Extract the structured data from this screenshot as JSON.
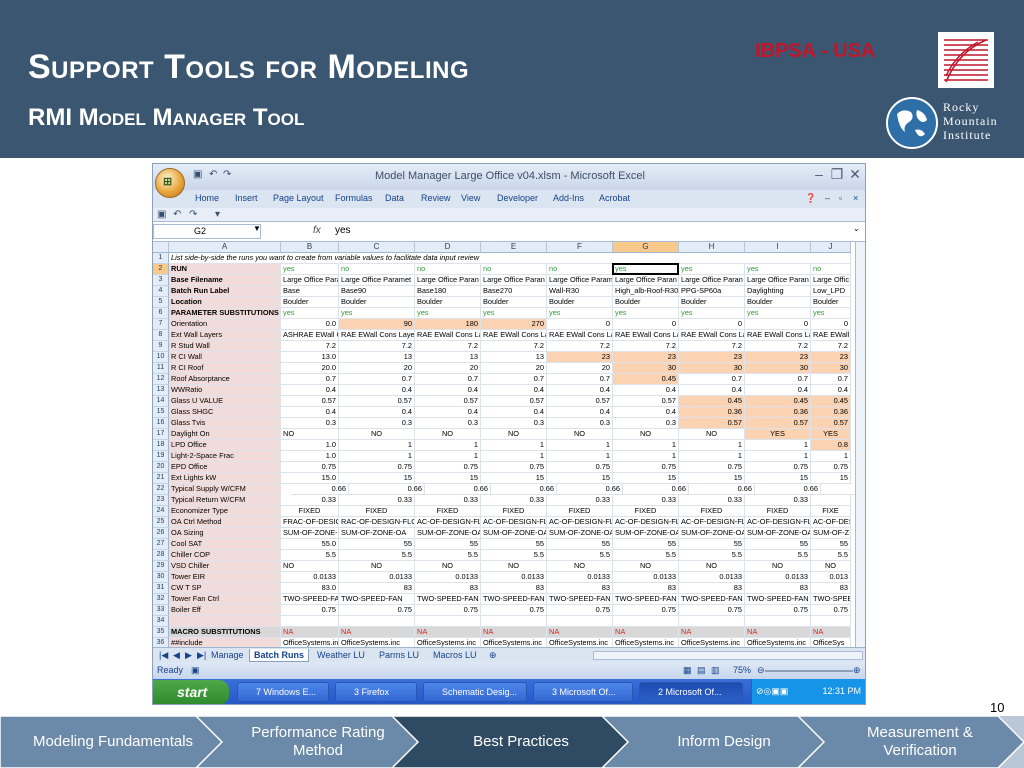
{
  "slide": {
    "title": "Support Tools for Modeling",
    "subtitle": "RMI Model Manager Tool",
    "ibpsa": "IBPSA - USA",
    "rmi_name": [
      "Rocky",
      "Mountain",
      "Institute"
    ],
    "page_number": "10"
  },
  "excel": {
    "window_title": "Model Manager Large Office v04.xlsm - Microsoft Excel",
    "ribbon_tabs": [
      "Home",
      "Insert",
      "Page Layout",
      "Formulas",
      "Data",
      "Review",
      "View",
      "Developer",
      "Add-Ins",
      "Acrobat"
    ],
    "name_box": "G2",
    "formula_value": "yes",
    "columns": [
      "A",
      "B",
      "C",
      "D",
      "E",
      "F",
      "G",
      "H",
      "I",
      "J"
    ],
    "rows": [
      {
        "n": "1",
        "cells": [
          "List side-by-side the runs you want to create from variable values to facilitate data input review"
        ]
      },
      {
        "n": "2",
        "cells": [
          "RUN",
          "yes",
          "no",
          "no",
          "no",
          "no",
          "yes",
          "yes",
          "yes",
          "no"
        ]
      },
      {
        "n": "3",
        "cells": [
          "Base Filename",
          "Large Office Para",
          "Large Office Paramet",
          "Large Office Paran",
          "Large Office Paran",
          "Large Office Param",
          "Large Office Paran",
          "Large Office Paran",
          "Large Office Paran",
          "Large Offic"
        ]
      },
      {
        "n": "4",
        "cells": [
          "Batch Run Label",
          "Base",
          "Base90",
          "Base180",
          "Base270",
          "Wall-R30",
          "High_alb-Roof-R30",
          "PPG-SP60a",
          "Daylighting",
          "Low_LPD"
        ]
      },
      {
        "n": "5",
        "cells": [
          "Location",
          "Boulder",
          "Boulder",
          "Boulder",
          "Boulder",
          "Boulder",
          "Boulder",
          "Boulder",
          "Boulder",
          "Boulder"
        ]
      },
      {
        "n": "6",
        "cells": [
          "PARAMETER SUBSTITUTIONS",
          "yes",
          "yes",
          "yes",
          "yes",
          "yes",
          "yes",
          "yes",
          "yes",
          "yes"
        ]
      },
      {
        "n": "7",
        "cells": [
          "Orientation",
          "0.0",
          "90",
          "180",
          "270",
          "0",
          "0",
          "0",
          "0",
          "0"
        ]
      },
      {
        "n": "8",
        "cells": [
          "Ext Wall Layers",
          "ASHRAE EWall C-H",
          "RAE EWall Cons Laye",
          "RAE EWall Cons La",
          "RAE EWall Cons La",
          "RAE EWall Cons Lay",
          "RAE EWall Cons La",
          "RAE EWall Cons La",
          "RAE EWall Cons La",
          "RAE EWall"
        ]
      },
      {
        "n": "9",
        "cells": [
          "R Stud Wall",
          "7.2",
          "7.2",
          "7.2",
          "7.2",
          "7.2",
          "7.2",
          "7.2",
          "7.2",
          "7.2"
        ]
      },
      {
        "n": "10",
        "cells": [
          "R CI Wall",
          "13.0",
          "13",
          "13",
          "13",
          "23",
          "23",
          "23",
          "23",
          "23"
        ]
      },
      {
        "n": "11",
        "cells": [
          "R CI Roof",
          "20.0",
          "20",
          "20",
          "20",
          "20",
          "30",
          "30",
          "30",
          "30"
        ]
      },
      {
        "n": "12",
        "cells": [
          "Roof Absorptance",
          "0.7",
          "0.7",
          "0.7",
          "0.7",
          "0.7",
          "0.45",
          "0.7",
          "0.7",
          "0.7"
        ]
      },
      {
        "n": "13",
        "cells": [
          "WWRatio",
          "0.4",
          "0.4",
          "0.4",
          "0.4",
          "0.4",
          "0.4",
          "0.4",
          "0.4",
          "0.4"
        ]
      },
      {
        "n": "14",
        "cells": [
          "Glass U VALUE",
          "0.57",
          "0.57",
          "0.57",
          "0.57",
          "0.57",
          "0.57",
          "0.45",
          "0.45",
          "0.45"
        ]
      },
      {
        "n": "15",
        "cells": [
          "Glass SHGC",
          "0.4",
          "0.4",
          "0.4",
          "0.4",
          "0.4",
          "0.4",
          "0.36",
          "0.36",
          "0.36"
        ]
      },
      {
        "n": "16",
        "cells": [
          "Glass Tvis",
          "0.3",
          "0.3",
          "0.3",
          "0.3",
          "0.3",
          "0.3",
          "0.57",
          "0.57",
          "0.57"
        ]
      },
      {
        "n": "17",
        "cells": [
          "Daylight On",
          "NO",
          "NO",
          "NO",
          "NO",
          "NO",
          "NO",
          "NO",
          "YES",
          "YES"
        ]
      },
      {
        "n": "18",
        "cells": [
          "LPD Office",
          "1.0",
          "1",
          "1",
          "1",
          "1",
          "1",
          "1",
          "1",
          "0.8"
        ]
      },
      {
        "n": "19",
        "cells": [
          "Light-2-Space Frac",
          "1.0",
          "1",
          "1",
          "1",
          "1",
          "1",
          "1",
          "1",
          "1"
        ]
      },
      {
        "n": "20",
        "cells": [
          "EPD Office",
          "0.75",
          "0.75",
          "0.75",
          "0.75",
          "0.75",
          "0.75",
          "0.75",
          "0.75",
          "0.75"
        ]
      },
      {
        "n": "21",
        "cells": [
          "Ext Lights kW",
          "15.0",
          "15",
          "15",
          "15",
          "15",
          "15",
          "15",
          "15",
          "15"
        ]
      },
      {
        "n": "22",
        "cells": [
          "Typical Supply W/CFM",
          "0.66",
          "0.66",
          "0.66",
          "0.66",
          "0.66",
          "0.66",
          "0.66",
          "0.66",
          ""
        ]
      },
      {
        "n": "23",
        "cells": [
          "Typical Return W/CFM",
          "0.33",
          "0.33",
          "0.33",
          "0.33",
          "0.33",
          "0.33",
          "0.33",
          "0.33",
          ""
        ]
      },
      {
        "n": "24",
        "cells": [
          "Economizer Type",
          "FIXED",
          "FIXED",
          "FIXED",
          "FIXED",
          "FIXED",
          "FIXED",
          "FIXED",
          "FIXED",
          "FIXE"
        ]
      },
      {
        "n": "25",
        "cells": [
          "OA Ctrl Method",
          "FRAC-OF-DESIGN",
          "RAC-OF-DESIGN-FLO",
          "AC-OF-DESIGN-FLC",
          "AC-OF-DESIGN-FLC",
          "AC-OF-DESIGN-FLO",
          "AC-OF-DESIGN-FLC",
          "AC-OF-DESIGN-FLC",
          "AC-OF-DESIGN-FLC",
          "AC-OF-DES"
        ]
      },
      {
        "n": "26",
        "cells": [
          "OA Sizing",
          "SUM-OF-ZONE-C",
          "SUM-OF-ZONE-OA",
          "SUM-OF-ZONE-OA",
          "SUM-OF-ZONE-OA",
          "SUM-OF-ZONE-OA",
          "SUM-OF-ZONE-OA",
          "SUM-OF-ZONE-OA",
          "SUM-OF-ZONE-OA",
          "SUM-OF-Z"
        ]
      },
      {
        "n": "27",
        "cells": [
          "Cool SAT",
          "55.0",
          "55",
          "55",
          "55",
          "55",
          "55",
          "55",
          "55",
          "55"
        ]
      },
      {
        "n": "28",
        "cells": [
          "Chiller COP",
          "5.5",
          "5.5",
          "5.5",
          "5.5",
          "5.5",
          "5.5",
          "5.5",
          "5.5",
          "5.5"
        ]
      },
      {
        "n": "29",
        "cells": [
          "VSD Chiller",
          "NO",
          "NO",
          "NO",
          "NO",
          "NO",
          "NO",
          "NO",
          "NO",
          "NO"
        ]
      },
      {
        "n": "30",
        "cells": [
          "Tower EIR",
          "0.0133",
          "0.0133",
          "0.0133",
          "0.0133",
          "0.0133",
          "0.0133",
          "0.0133",
          "0.0133",
          "0.013"
        ]
      },
      {
        "n": "31",
        "cells": [
          "CW T SP",
          "83.0",
          "83",
          "83",
          "83",
          "83",
          "83",
          "83",
          "83",
          "83"
        ]
      },
      {
        "n": "32",
        "cells": [
          "Tower Fan Ctrl",
          "TWO-SPEED-FAN",
          "TWO-SPEED-FAN",
          "TWO-SPEED-FAN",
          "TWO-SPEED-FAN",
          "TWO-SPEED-FAN",
          "TWO-SPEED-FAN",
          "TWO-SPEED-FAN",
          "TWO-SPEED-FAN",
          "TWO-SPEE"
        ]
      },
      {
        "n": "33",
        "cells": [
          "Boiler Eff",
          "0.75",
          "0.75",
          "0.75",
          "0.75",
          "0.75",
          "0.75",
          "0.75",
          "0.75",
          "0.75"
        ]
      },
      {
        "n": "34",
        "cells": [
          "",
          "",
          "",
          "",
          "",
          "",
          "",
          "",
          "",
          ""
        ]
      },
      {
        "n": "35",
        "cells": [
          "MACRO SUBSTITUTIONS",
          "NA",
          "NA",
          "NA",
          "NA",
          "NA",
          "NA",
          "NA",
          "NA",
          "NA"
        ]
      },
      {
        "n": "36",
        "cells": [
          "##include",
          "OfficeSystems.inc",
          "OfficeSystems.inc",
          "OfficeSystems.inc",
          "OfficeSystems.inc",
          "OfficeSystems.inc",
          "OfficeSystems.inc",
          "OfficeSystems.inc",
          "OfficeSystems.inc",
          "OfficeSys"
        ]
      }
    ],
    "sheet_tabs": [
      "Manage",
      "Batch Runs",
      "Weather LU",
      "Parms LU",
      "Macros LU"
    ],
    "active_sheet": "Batch Runs",
    "status": "Ready",
    "zoom": "75%",
    "taskbar": {
      "start": "start",
      "items": [
        "7 Windows E...",
        "3 Firefox",
        "Schematic Desig...",
        "3 Microsoft Of...",
        "2 Microsoft Of..."
      ],
      "clock": "12:31 PM"
    }
  },
  "nav": {
    "items": [
      "Modeling Fundamentals",
      "Performance Rating Method",
      "Best Practices",
      "Inform Design",
      "Measurement & Verification"
    ],
    "active_index": 2,
    "colors": {
      "inactive": "#6b89a8",
      "active": "#2f4a63",
      "bar": "#bac7d6"
    }
  }
}
